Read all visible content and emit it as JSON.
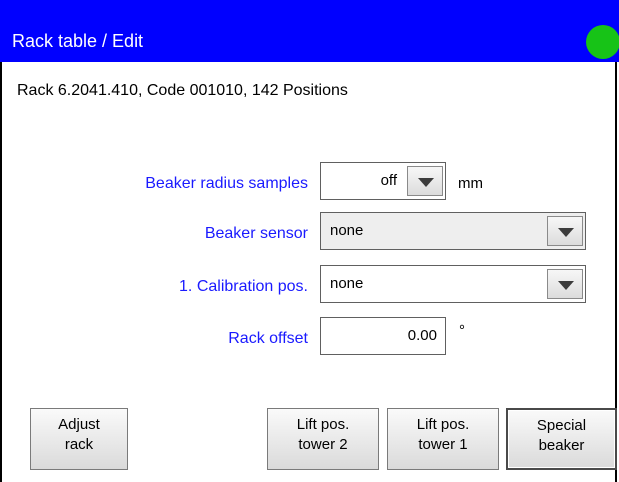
{
  "header": {
    "title": "Rack table / Edit",
    "status_color": "#17c317"
  },
  "subtitle": "Rack 6.2041.410, Code 001010, 142 Positions",
  "form": {
    "beaker_radius": {
      "label": "Beaker radius samples",
      "value": "off",
      "unit": "mm"
    },
    "beaker_sensor": {
      "label": "Beaker sensor",
      "value": "none"
    },
    "calibration_pos": {
      "label": "1. Calibration pos.",
      "value": "none"
    },
    "rack_offset": {
      "label": "Rack offset",
      "value": "0.00",
      "unit": "°"
    }
  },
  "buttons": {
    "adjust_rack": [
      "Adjust",
      "rack"
    ],
    "lift_tower2": [
      "Lift pos.",
      "tower 2"
    ],
    "lift_tower1": [
      "Lift pos.",
      "tower 1"
    ],
    "special_beaker": [
      "Special",
      "beaker"
    ]
  },
  "colors": {
    "titlebar": "#0000ff",
    "label_text": "#1a1aff"
  }
}
